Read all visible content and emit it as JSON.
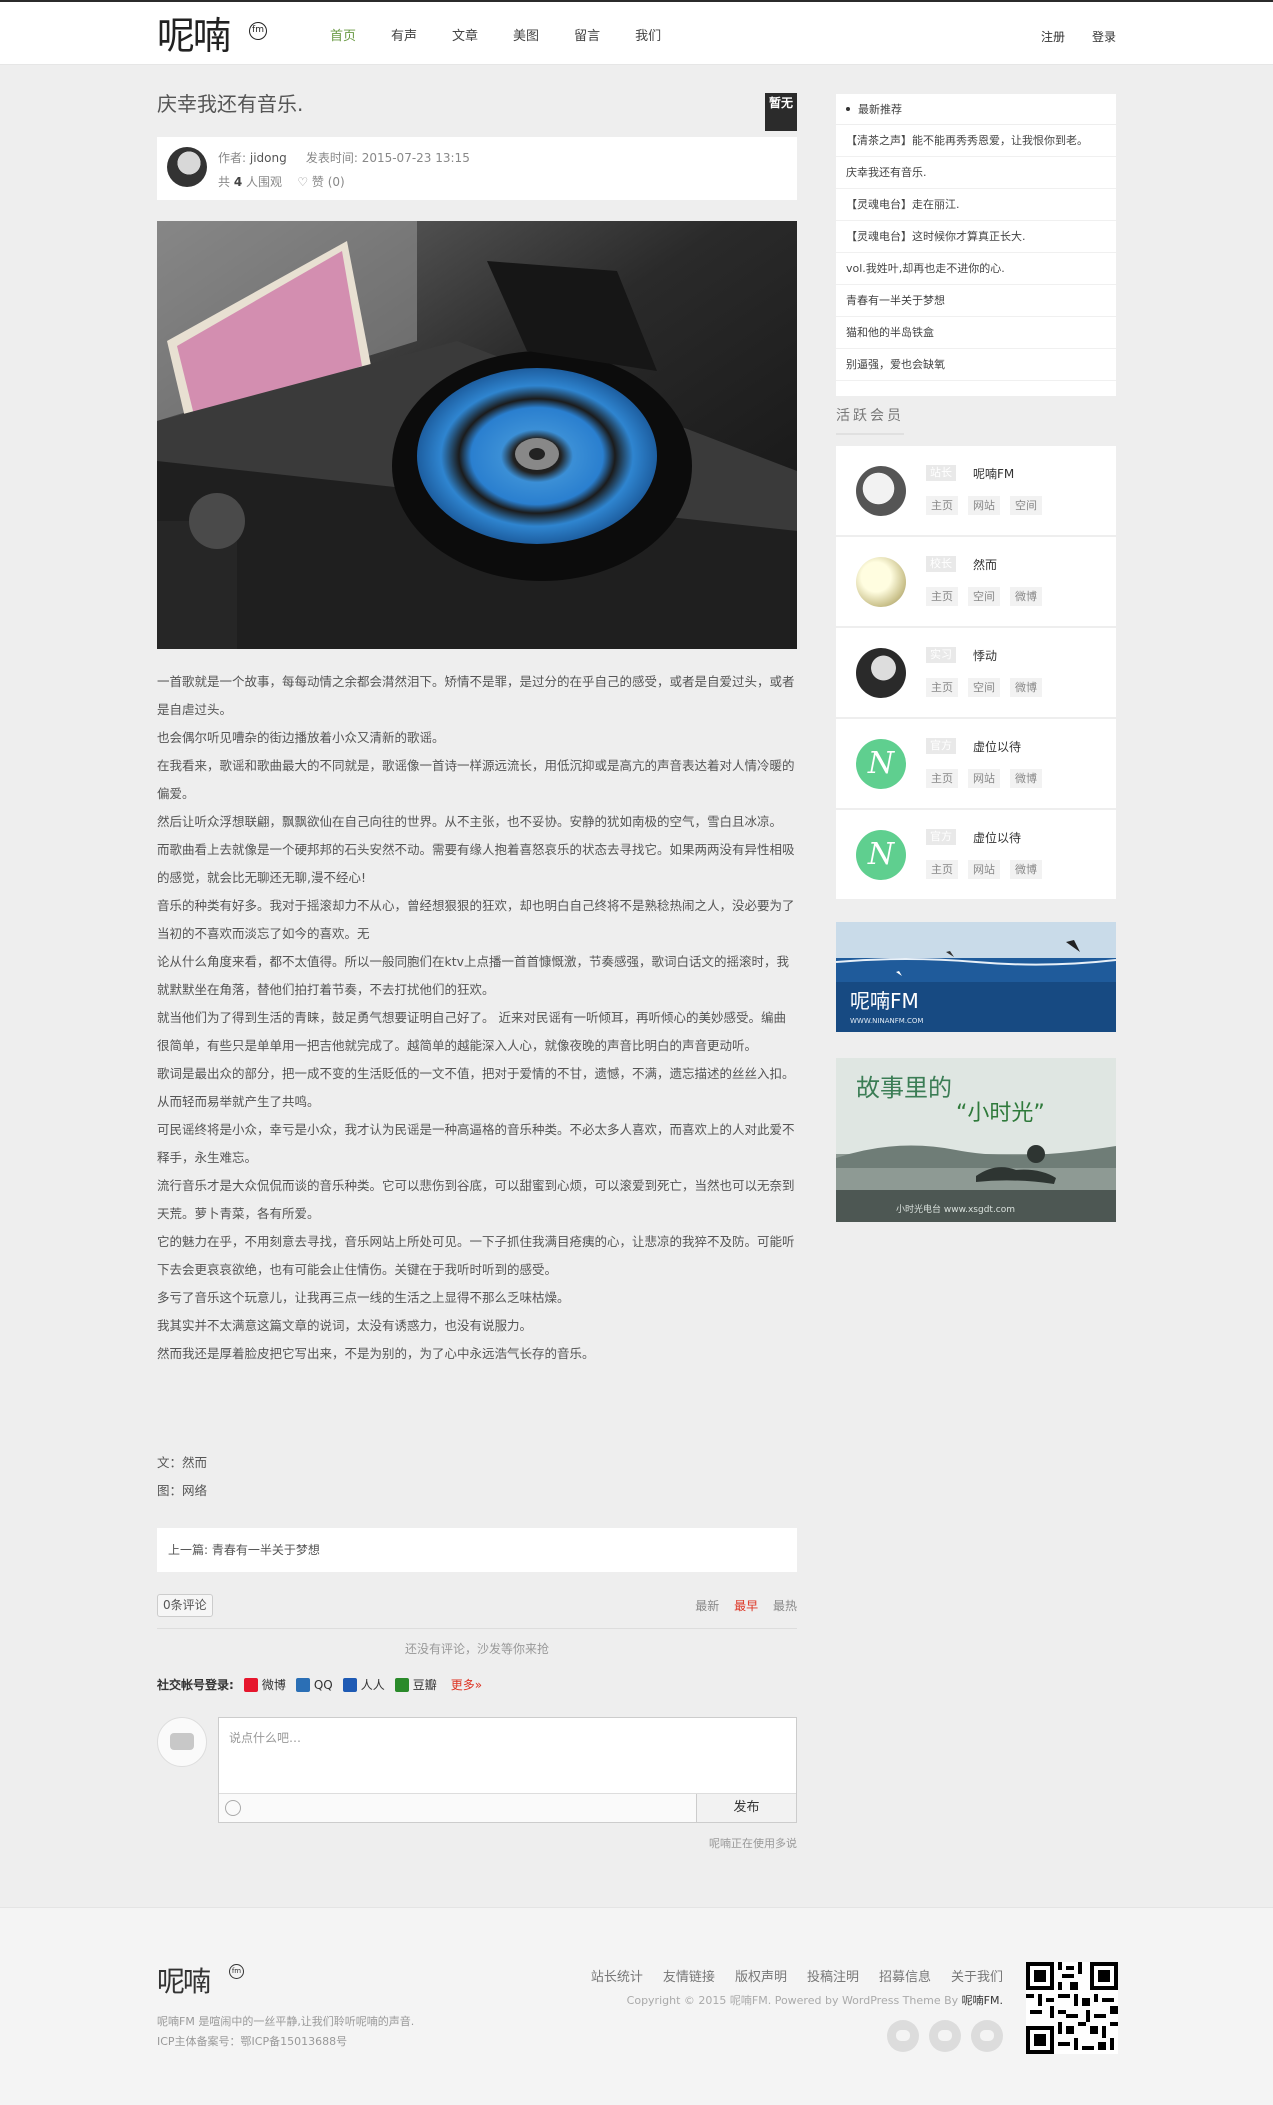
{
  "brand": {
    "name": "呢喃",
    "fm": "fm"
  },
  "nav": [
    {
      "label": "首页",
      "active": true
    },
    {
      "label": "有声"
    },
    {
      "label": "文章"
    },
    {
      "label": "美图"
    },
    {
      "label": "留言"
    },
    {
      "label": "我们"
    }
  ],
  "auth": {
    "register": "注册",
    "login": "登录"
  },
  "post": {
    "title": "庆幸我还有音乐.",
    "badge": "暂无",
    "author_label": "作者:",
    "author": "jidong",
    "time_label": "发表时间:",
    "time": "2015-07-23 13:15",
    "views_pre": "共",
    "views": "4",
    "views_post": "人围观",
    "likes": "赞 (0)",
    "paragraphs": [
      "一首歌就是一个故事，每每动情之余都会潸然泪下。矫情不是罪，是过分的在乎自己的感受，或者是自爱过头，或者是自虐过头。",
      "也会偶尔听见嘈杂的街边播放着小众又清新的歌谣。",
      "在我看来，歌谣和歌曲最大的不同就是，歌谣像一首诗一样源远流长，用低沉抑或是高亢的声音表达着对人情冷暖的偏爱。",
      "然后让听众浮想联翩，飘飘欲仙在自己向往的世界。从不主张，也不妥协。安静的犹如南极的空气，雪白且冰凉。",
      "而歌曲看上去就像是一个硬邦邦的石头安然不动。需要有缘人抱着喜怒哀乐的状态去寻找它。如果两两没有异性相吸的感觉，就会比无聊还无聊,漫不经心!",
      "音乐的种类有好多。我对于摇滚却力不从心，曾经想狠狠的狂欢，却也明白自己终将不是熟稔热闹之人，没必要为了当初的不喜欢而淡忘了如今的喜欢。无",
      "论从什么角度来看，都不太值得。所以一般同胞们在ktv上点播一首首慷慨激，节奏感强，歌词白话文的摇滚时，我就默默坐在角落，替他们拍打着节奏，不去打扰他们的狂欢。",
      "就当他们为了得到生活的青睐，鼓足勇气想要证明自己好了。 近来对民谣有一听倾耳，再听倾心的美妙感受。编曲很简单，有些只是单单用一把吉他就完成了。越简单的越能深入人心，就像夜晚的声音比明白的声音更动听。",
      "歌词是最出众的部分，把一成不变的生活贬低的一文不值，把对于爱情的不甘，遗憾，不满，遗忘描述的丝丝入扣。从而轻而易举就产生了共鸣。",
      "可民谣终将是小众，幸亏是小众，我才认为民谣是一种高逼格的音乐种类。不必太多人喜欢，而喜欢上的人对此爱不释手，永生难忘。",
      "流行音乐才是大众侃侃而谈的音乐种类。它可以悲伤到谷底，可以甜蜜到心烦，可以滚爱到死亡，当然也可以无奈到天荒。萝卜青菜，各有所爱。",
      "它的魅力在乎，不用刻意去寻找，音乐网站上所处可见。一下子抓住我满目疮痍的心，让悲凉的我猝不及防。可能听下去会更哀哀欲绝，也有可能会止住情伤。关键在于我听时听到的感受。",
      "多亏了音乐这个玩意儿，让我再三点一线的生活之上显得不那么乏味枯燥。",
      "我其实并不太满意这篇文章的说词，太没有诱惑力，也没有说服力。",
      "然而我还是厚着脸皮把它写出来，不是为别的，为了心中永远浩气长存的音乐。"
    ],
    "credit_text": "文：然而",
    "credit_img": "图：网络",
    "prev_label": "上一篇:",
    "prev_title": "青春有一半关于梦想"
  },
  "comments": {
    "count": "0条评论",
    "sort_new": "最新",
    "sort_old": "最早",
    "sort_hot": "最热",
    "empty": "还没有评论，沙发等你来抢",
    "social_label": "社交帐号登录:",
    "social": [
      "微博",
      "QQ",
      "人人",
      "豆瓣"
    ],
    "social_more": "更多»",
    "placeholder": "说点什么吧…",
    "submit": "发布",
    "powered": "呢喃正在使用多说"
  },
  "sidebar": {
    "rec_title": "最新推荐",
    "rec_items": [
      "【清茶之声】能不能再秀秀恩爱，让我恨你到老。",
      "庆幸我还有音乐.",
      "【灵魂电台】走在丽江.",
      "【灵魂电台】这时候你才算真正长大.",
      "vol.我姓叶,却再也走不进你的心.",
      "青春有一半关于梦想",
      "猫和他的半岛铁盒",
      "别逼强，爱也会缺氧"
    ],
    "active_title": "活跃会员",
    "members": [
      {
        "role": "站长",
        "name": "呢喃FM",
        "links": [
          "主页",
          "网站",
          "空间"
        ]
      },
      {
        "role": "校长",
        "name": "然而",
        "links": [
          "主页",
          "空间",
          "微博"
        ]
      },
      {
        "role": "实习",
        "name": "悸动",
        "links": [
          "主页",
          "空间",
          "微博"
        ]
      },
      {
        "role": "官方",
        "name": "虚位以待",
        "links": [
          "主页",
          "网站",
          "微博"
        ]
      },
      {
        "role": "官方",
        "name": "虚位以待",
        "links": [
          "主页",
          "网站",
          "微博"
        ]
      }
    ],
    "banner1_text": "呢喃FM",
    "banner1_url": "WWW.NINANFM.COM",
    "banner2_title": "故事里的",
    "banner2_sub": "“小时光”",
    "banner2_url": "小时光电台  www.xsgdt.com"
  },
  "footer": {
    "links": [
      "站长统计",
      "友情链接",
      "版权声明",
      "投稿注明",
      "招募信息",
      "关于我们"
    ],
    "copy_pre": "Copyright © 2015 呢喃FM. Powered by WordPress Theme By",
    "copy_brand": "呢喃FM.",
    "desc1": "呢喃FM 是喧闹中的一丝平静,让我们聆听呢喃的声音.",
    "desc2": "ICP主体备案号：鄂ICP备15013688号"
  },
  "colors": {
    "accent": "#6a9a44",
    "hot": "#d32f2f",
    "dark": "#2b2b2b"
  }
}
